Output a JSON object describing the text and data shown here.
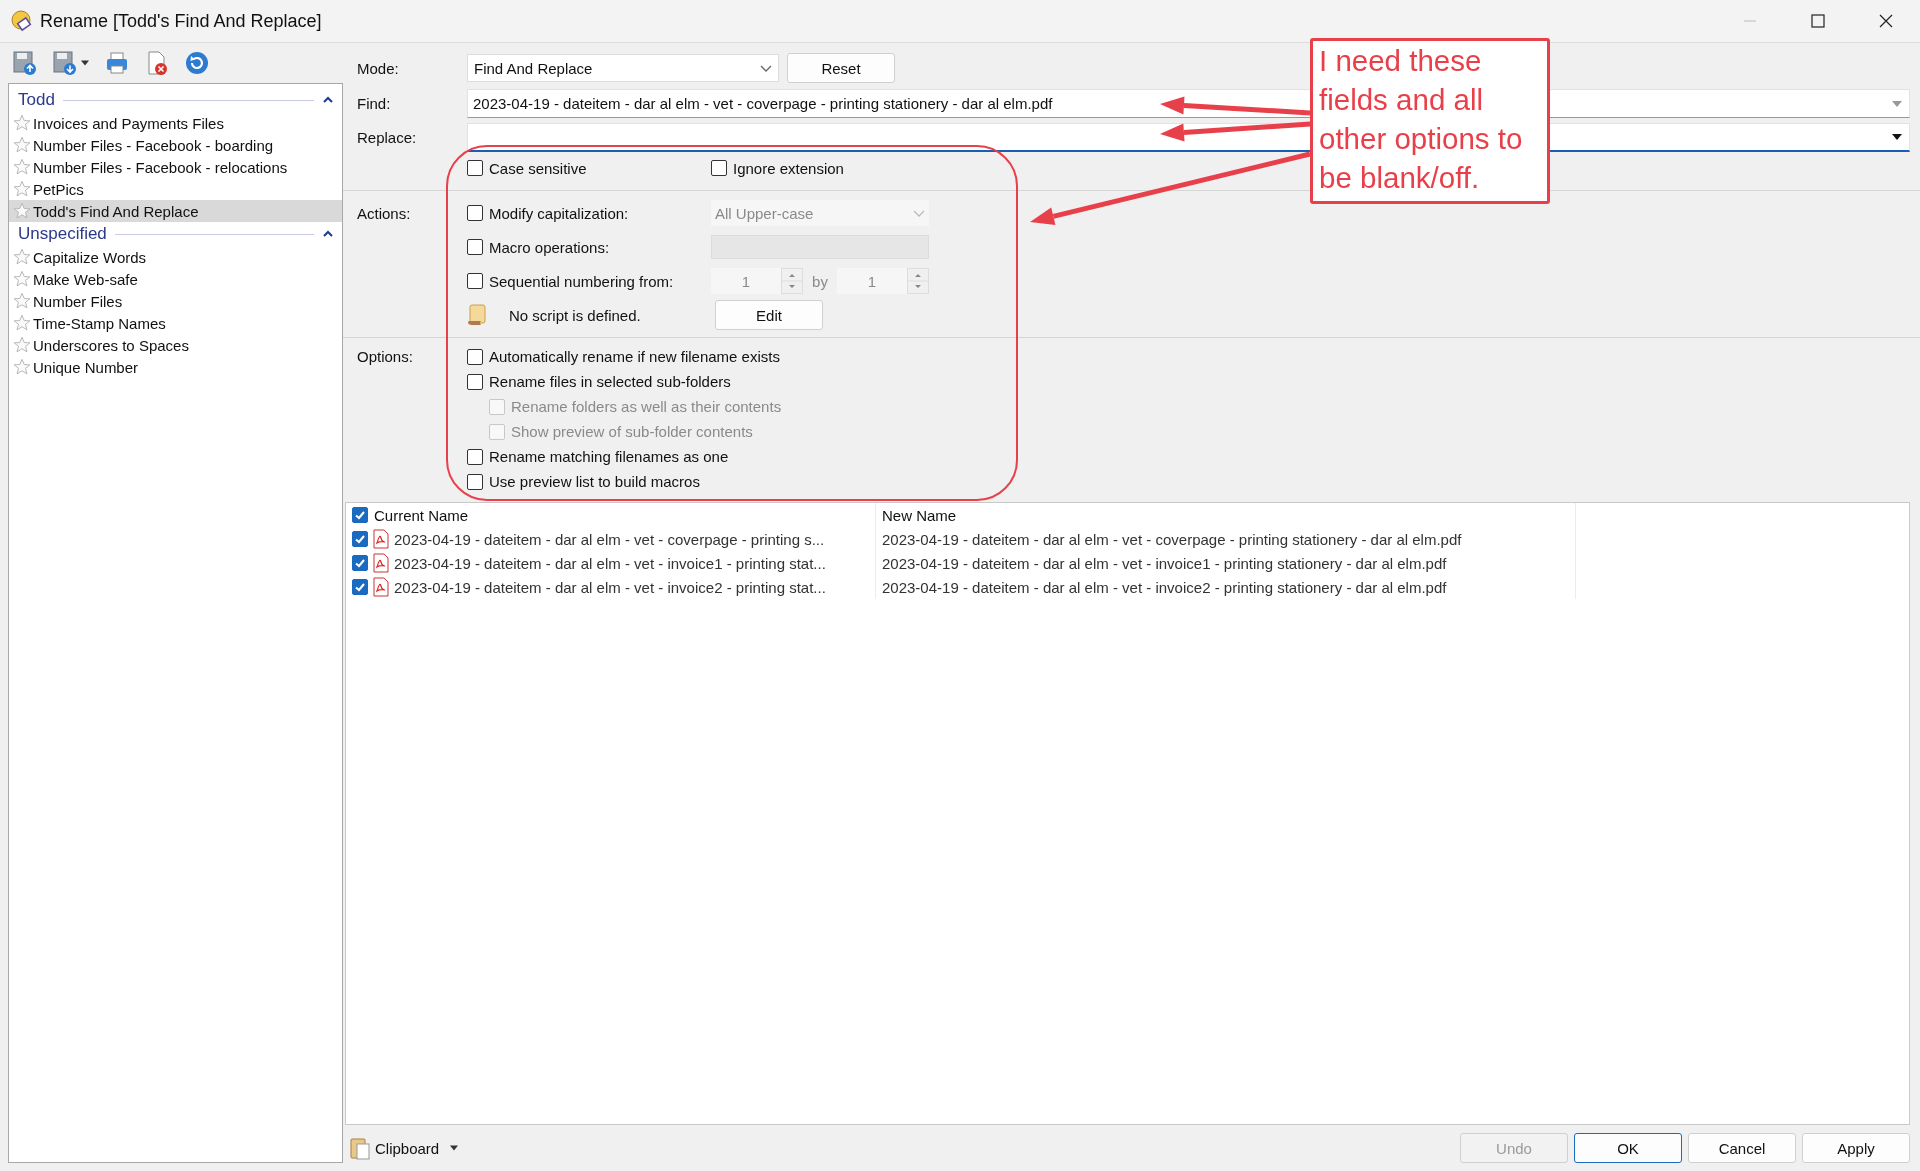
{
  "window": {
    "title": "Rename [Todd's Find And Replace]"
  },
  "sidebar": {
    "groups": [
      {
        "title": "Todd",
        "expanded": true,
        "items": [
          {
            "label": "Invoices and Payments Files",
            "selected": false
          },
          {
            "label": "Number Files - Facebook - boarding",
            "selected": false
          },
          {
            "label": "Number Files - Facebook - relocations",
            "selected": false
          },
          {
            "label": "PetPics",
            "selected": false
          },
          {
            "label": "Todd's Find And Replace",
            "selected": true
          }
        ]
      },
      {
        "title": "Unspecified",
        "expanded": true,
        "items": [
          {
            "label": "Capitalize Words",
            "selected": false
          },
          {
            "label": "Make Web-safe",
            "selected": false
          },
          {
            "label": "Number Files",
            "selected": false
          },
          {
            "label": "Time-Stamp Names",
            "selected": false
          },
          {
            "label": "Underscores to Spaces",
            "selected": false
          },
          {
            "label": "Unique Number",
            "selected": false
          }
        ]
      }
    ]
  },
  "form": {
    "mode": {
      "label": "Mode:",
      "value": "Find And Replace"
    },
    "reset_button": "Reset",
    "find": {
      "label": "Find:",
      "value": "2023-04-19 - dateitem - dar al elm - vet - coverpage - printing stationery - dar al elm.pdf"
    },
    "replace": {
      "label": "Replace:",
      "focused": true
    },
    "checks": [
      {
        "label": "Case sensitive",
        "checked": false
      },
      {
        "label": "Ignore extension",
        "checked": false
      }
    ]
  },
  "actions": {
    "label": "Actions:",
    "items": [
      {
        "kind": "select",
        "label": "Modify capitalization:",
        "checked": false,
        "value": "All Upper-case",
        "disabled": true
      },
      {
        "kind": "text",
        "label": "Macro operations:",
        "checked": false,
        "disabled": true
      },
      {
        "kind": "spin",
        "label": "Sequential numbering from:",
        "checked": false,
        "from": "1",
        "by_label": "by",
        "by": "1",
        "disabled": true
      },
      {
        "kind": "script",
        "label": "No script is defined.",
        "button": "Edit"
      }
    ]
  },
  "options": {
    "label": "Options:",
    "items": [
      {
        "label": "Automatically rename if new filename exists",
        "checked": false,
        "disabled": false
      },
      {
        "label": "Rename files in selected sub-folders",
        "checked": false,
        "disabled": false,
        "children": [
          {
            "label": "Rename folders as well as their contents",
            "checked": false,
            "disabled": true
          },
          {
            "label": "Show preview of sub-folder contents",
            "checked": false,
            "disabled": true
          }
        ]
      },
      {
        "label": "Rename matching filenames as one",
        "checked": false,
        "disabled": false
      },
      {
        "label": "Use preview list to build macros",
        "checked": false,
        "disabled": false
      }
    ]
  },
  "file_list": {
    "columns": [
      "Current Name",
      "New Name"
    ],
    "all_checked": true,
    "rows": [
      {
        "checked": true,
        "current_name": "2023-04-19 - dateitem - dar al elm - vet - coverpage - printing s...",
        "new_name": "2023-04-19 - dateitem - dar al elm - vet - coverpage - printing stationery - dar al elm.pdf"
      },
      {
        "checked": true,
        "current_name": "2023-04-19 - dateitem - dar al elm - vet - invoice1 - printing stat...",
        "new_name": "2023-04-19 - dateitem - dar al elm - vet - invoice1 - printing stationery - dar al elm.pdf"
      },
      {
        "checked": true,
        "current_name": "2023-04-19 - dateitem - dar al elm - vet - invoice2 - printing stat...",
        "new_name": "2023-04-19 - dateitem - dar al elm - vet - invoice2 - printing stationery - dar al elm.pdf"
      }
    ]
  },
  "bottom_bar": {
    "clipboard": "Clipboard",
    "buttons": [
      {
        "label": "Undo",
        "disabled": true,
        "default": false
      },
      {
        "label": "OK",
        "disabled": false,
        "default": true
      },
      {
        "label": "Cancel",
        "disabled": false,
        "default": false
      },
      {
        "label": "Apply",
        "disabled": false,
        "default": false
      }
    ]
  },
  "annotation": {
    "text": "I need these fields and all other options to be blank/off."
  }
}
